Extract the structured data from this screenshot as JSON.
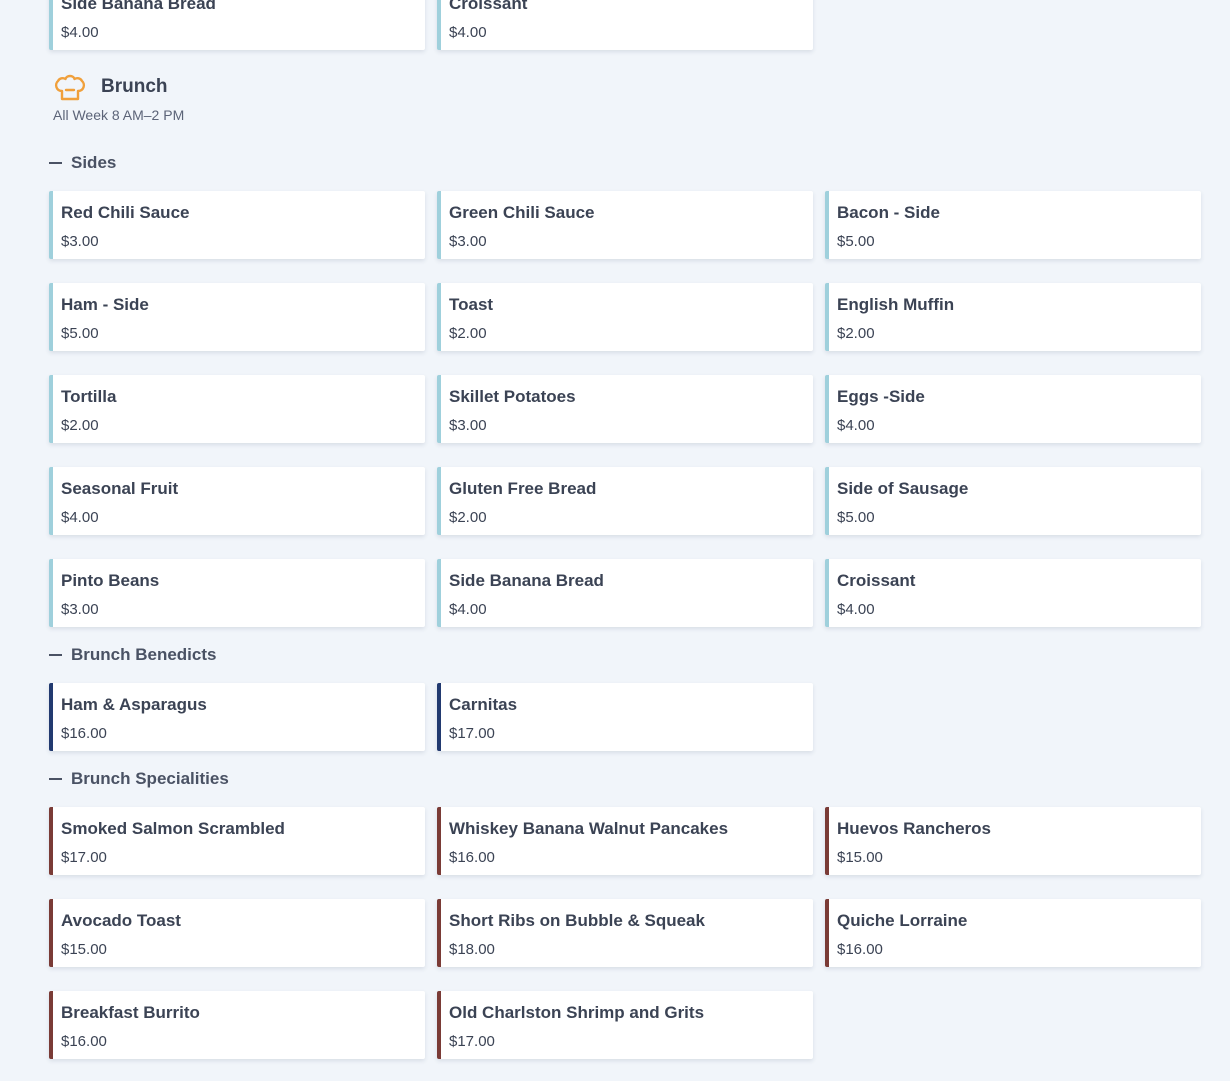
{
  "previous_section": {
    "items": [
      {
        "name": "Side Banana Bread",
        "price": "$4.00"
      },
      {
        "name": "Croissant",
        "price": "$4.00"
      }
    ]
  },
  "menu": {
    "title": "Brunch",
    "hours": "All Week 8 AM–2 PM",
    "icon": "chef-hat-icon",
    "icon_color": "#f0a03c"
  },
  "sections": {
    "sides": {
      "title": "Sides",
      "accent": "#9fd0dc",
      "items": [
        {
          "name": "Red Chili Sauce",
          "price": "$3.00"
        },
        {
          "name": "Green Chili Sauce",
          "price": "$3.00"
        },
        {
          "name": "Bacon - Side",
          "price": "$5.00"
        },
        {
          "name": "Ham - Side",
          "price": "$5.00"
        },
        {
          "name": "Toast",
          "price": "$2.00"
        },
        {
          "name": "English Muffin",
          "price": "$2.00"
        },
        {
          "name": "Tortilla",
          "price": "$2.00"
        },
        {
          "name": "Skillet Potatoes",
          "price": "$3.00"
        },
        {
          "name": "Eggs -Side",
          "price": "$4.00"
        },
        {
          "name": "Seasonal Fruit",
          "price": "$4.00"
        },
        {
          "name": "Gluten Free Bread",
          "price": "$2.00"
        },
        {
          "name": "Side of Sausage",
          "price": "$5.00"
        },
        {
          "name": "Pinto Beans",
          "price": "$3.00"
        },
        {
          "name": "Side Banana Bread",
          "price": "$4.00"
        },
        {
          "name": "Croissant",
          "price": "$4.00"
        }
      ]
    },
    "benedicts": {
      "title": "Brunch Benedicts",
      "accent": "#223a70",
      "items": [
        {
          "name": "Ham & Asparagus",
          "price": "$16.00"
        },
        {
          "name": "Carnitas",
          "price": "$17.00"
        }
      ]
    },
    "specialities": {
      "title": "Brunch Specialities",
      "accent": "#7a3b36",
      "items": [
        {
          "name": "Smoked Salmon Scrambled",
          "price": "$17.00"
        },
        {
          "name": "Whiskey Banana Walnut Pancakes",
          "price": "$16.00"
        },
        {
          "name": "Huevos Rancheros",
          "price": "$15.00"
        },
        {
          "name": "Avocado Toast",
          "price": "$15.00"
        },
        {
          "name": "Short Ribs on Bubble & Squeak",
          "price": "$18.00"
        },
        {
          "name": "Quiche Lorraine",
          "price": "$16.00"
        },
        {
          "name": "Breakfast Burrito",
          "price": "$16.00"
        },
        {
          "name": "Old Charlston Shrimp and Grits",
          "price": "$17.00"
        }
      ]
    }
  }
}
